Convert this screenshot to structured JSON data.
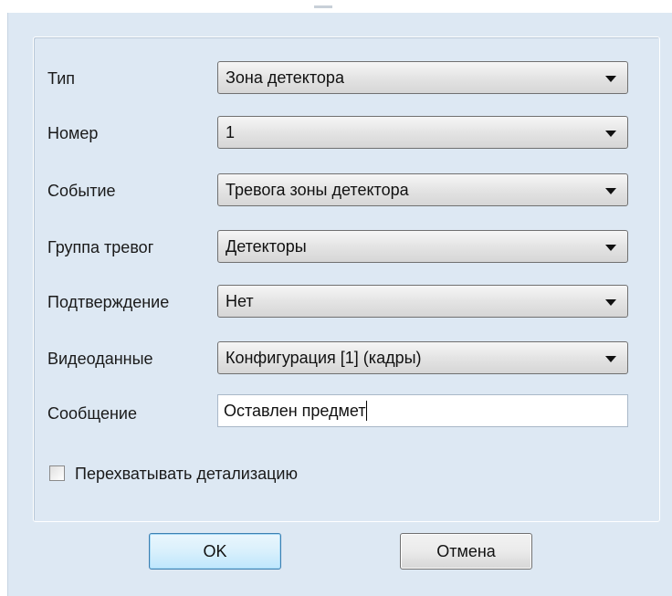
{
  "form": {
    "type_label": "Тип",
    "type_value": "Зона детектора",
    "number_label": "Номер",
    "number_value": "1",
    "event_label": "Событие",
    "event_value": "Тревога зоны детектора",
    "alarm_group_label": "Группа тревог",
    "alarm_group_value": "Детекторы",
    "confirmation_label": "Подтверждение",
    "confirmation_value": "Нет",
    "video_label": "Видеоданные",
    "video_value": "Конфигурация [1] (кадры)",
    "message_label": "Сообщение",
    "message_value": "Оставлен предмет",
    "intercept_label": "Перехватывать детализацию",
    "intercept_checked": false
  },
  "buttons": {
    "ok_label": "OK",
    "cancel_label": "Отмена"
  },
  "colors": {
    "panel_background": "#dde8f3",
    "ok_button_border": "#3c7fb1"
  }
}
